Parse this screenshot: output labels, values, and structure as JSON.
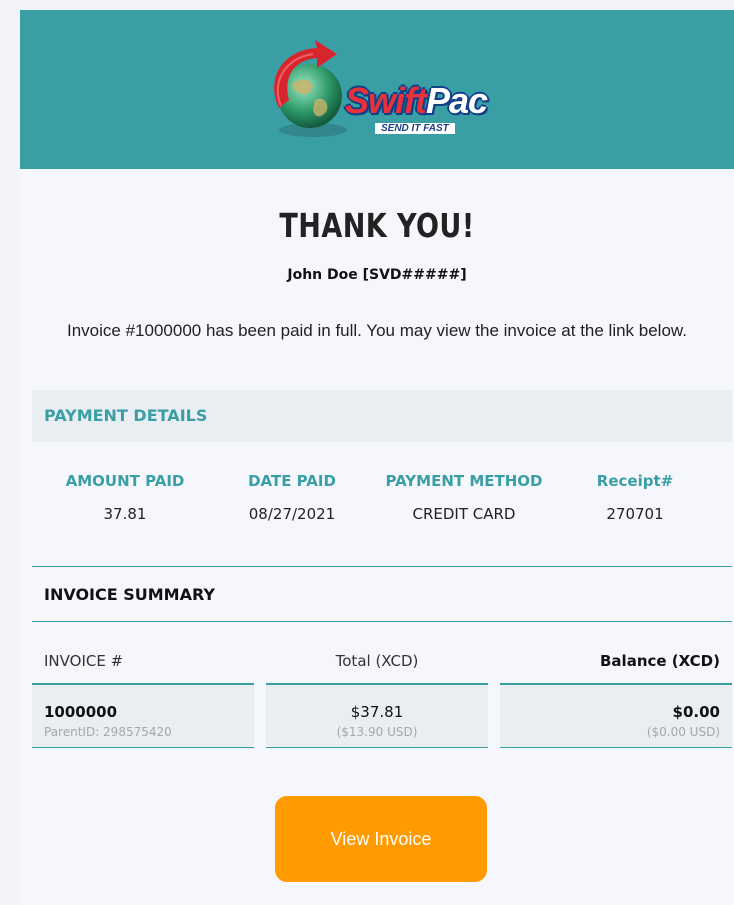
{
  "header": {
    "brand_name_part1": "Swift",
    "brand_name_part2": "Pac",
    "brand_tagline": "SEND IT FAST",
    "logo_icon": "globe-with-arrow-icon",
    "background_color": "#3a9fa4"
  },
  "confirmation": {
    "title": "THANK YOU!",
    "customer": "John Doe [SVD#####]",
    "message": "Invoice #1000000 has been paid in full. You may view the invoice at the link below."
  },
  "payment_details": {
    "title": "PAYMENT DETAILS",
    "columns": [
      {
        "label": "AMOUNT PAID",
        "value": "37.81"
      },
      {
        "label": "DATE PAID",
        "value": "08/27/2021"
      },
      {
        "label": "PAYMENT METHOD",
        "value": "CREDIT CARD"
      },
      {
        "label": "Receipt#",
        "value": "270701"
      }
    ]
  },
  "invoice_summary": {
    "title": "INVOICE SUMMARY",
    "headers": {
      "invoice": "INVOICE #",
      "total": "Total (XCD)",
      "balance": "Balance (XCD)"
    },
    "row": {
      "invoice_number": "1000000",
      "parent_id": "ParentID: 298575420",
      "total": "$37.81",
      "total_usd": "($13.90 USD)",
      "balance": "$0.00",
      "balance_usd": "($0.00 USD)"
    }
  },
  "actions": {
    "view_invoice_label": "View Invoice",
    "button_color": "#ff9a00"
  },
  "colors": {
    "accent_teal": "#3a9fa4",
    "brand_red": "#e8323a",
    "brand_blue": "#1b3f8c"
  }
}
